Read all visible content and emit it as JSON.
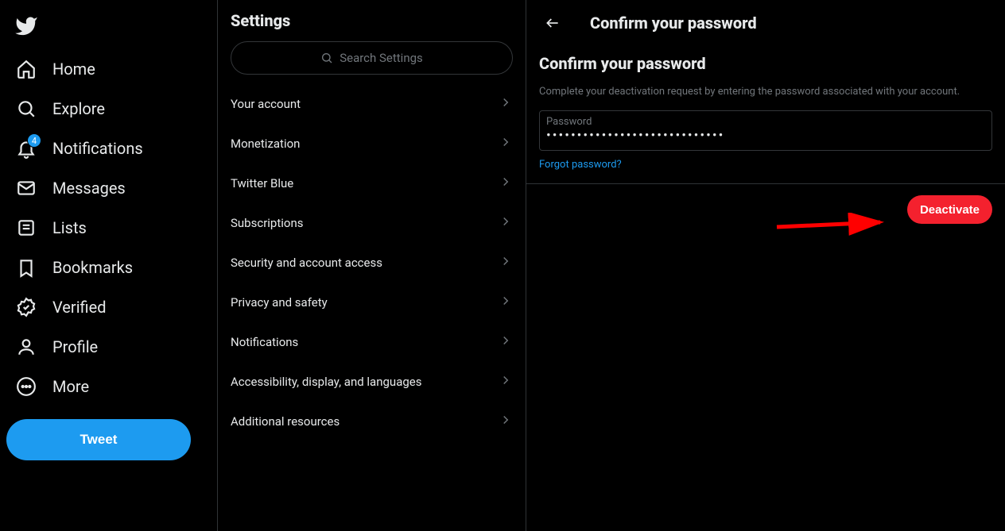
{
  "nav": {
    "home": "Home",
    "explore": "Explore",
    "notifications": "Notifications",
    "notifications_badge": "4",
    "messages": "Messages",
    "lists": "Lists",
    "bookmarks": "Bookmarks",
    "verified": "Verified",
    "profile": "Profile",
    "more": "More",
    "tweet": "Tweet"
  },
  "settings": {
    "title": "Settings",
    "search_placeholder": "Search Settings",
    "items": [
      "Your account",
      "Monetization",
      "Twitter Blue",
      "Subscriptions",
      "Security and account access",
      "Privacy and safety",
      "Notifications",
      "Accessibility, display, and languages",
      "Additional resources"
    ]
  },
  "detail": {
    "header_title": "Confirm your password",
    "subtitle": "Confirm your password",
    "description": "Complete your deactivation request by entering the password associated with your account.",
    "password_label": "Password",
    "password_value": "•••••••••••••••••••••••••••••",
    "forgot": "Forgot password?",
    "deactivate": "Deactivate"
  }
}
